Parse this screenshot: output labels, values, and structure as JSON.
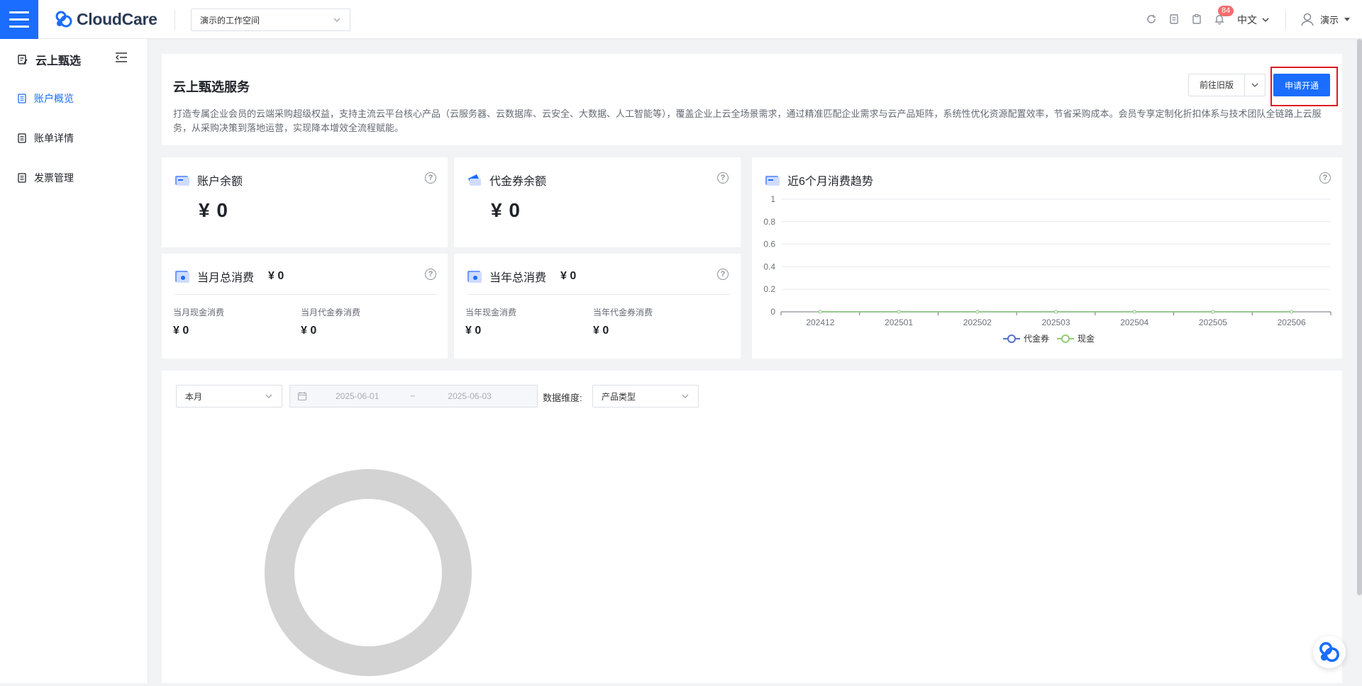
{
  "header": {
    "brand": "CloudCare",
    "workspace": "演示的工作空间",
    "notification_count": "84",
    "language": "中文",
    "user": "演示"
  },
  "sidebar": {
    "title": "云上甄选",
    "items": [
      {
        "label": "账户概览",
        "active": true
      },
      {
        "label": "账单详情",
        "active": false
      },
      {
        "label": "发票管理",
        "active": false
      }
    ]
  },
  "intro": {
    "title": "云上甄选服务",
    "description": "打造专属企业会员的云端采购超级权益，支持主流云平台核心产品（云服务器、云数据库、云安全、大数据、人工智能等），覆盖企业上云全场景需求，通过精准匹配企业需求与云产品矩阵，系统性优化资源配置效率，节省采购成本。会员专享定制化折扣体系与技术团队全链路上云服务，从采购决策到落地运营，实现降本增效全流程赋能。",
    "old_version_label": "前往旧版",
    "apply_label": "申请开通"
  },
  "account_balance": {
    "title": "账户余额",
    "amount": "¥ 0"
  },
  "voucher_balance": {
    "title": "代金券余额",
    "amount": "¥ 0"
  },
  "month_total": {
    "title": "当月总消费",
    "amount": "¥ 0",
    "cash_label": "当月现金消费",
    "cash_value": "¥ 0",
    "voucher_label": "当月代金券消费",
    "voucher_value": "¥ 0"
  },
  "year_total": {
    "title": "当年总消费",
    "amount": "¥ 0",
    "cash_label": "当年现金消费",
    "cash_value": "¥ 0",
    "voucher_label": "当年代金券消费",
    "voucher_value": "¥ 0"
  },
  "trend": {
    "title": "近6个月消费趋势"
  },
  "chart_data": {
    "type": "line",
    "title": "近6个月消费趋势",
    "categories": [
      "202412",
      "202501",
      "202502",
      "202503",
      "202504",
      "202505",
      "202506"
    ],
    "series": [
      {
        "name": "代金券",
        "values": [
          0,
          0,
          0,
          0,
          0,
          0,
          0
        ],
        "color": "#5470c6"
      },
      {
        "name": "现金",
        "values": [
          0,
          0,
          0,
          0,
          0,
          0,
          0
        ],
        "color": "#91cc75"
      }
    ],
    "yticks": [
      "0",
      "0.2",
      "0.4",
      "0.6",
      "0.8",
      "1"
    ],
    "ylim": [
      0,
      1
    ],
    "legend_position": "bottom-center",
    "grid": true
  },
  "filters": {
    "period": "本月",
    "start_date": "2025-06-01",
    "tilde": "~",
    "end_date": "2025-06-03",
    "dimension_label": "数据维度:",
    "dimension_value": "产品类型"
  }
}
